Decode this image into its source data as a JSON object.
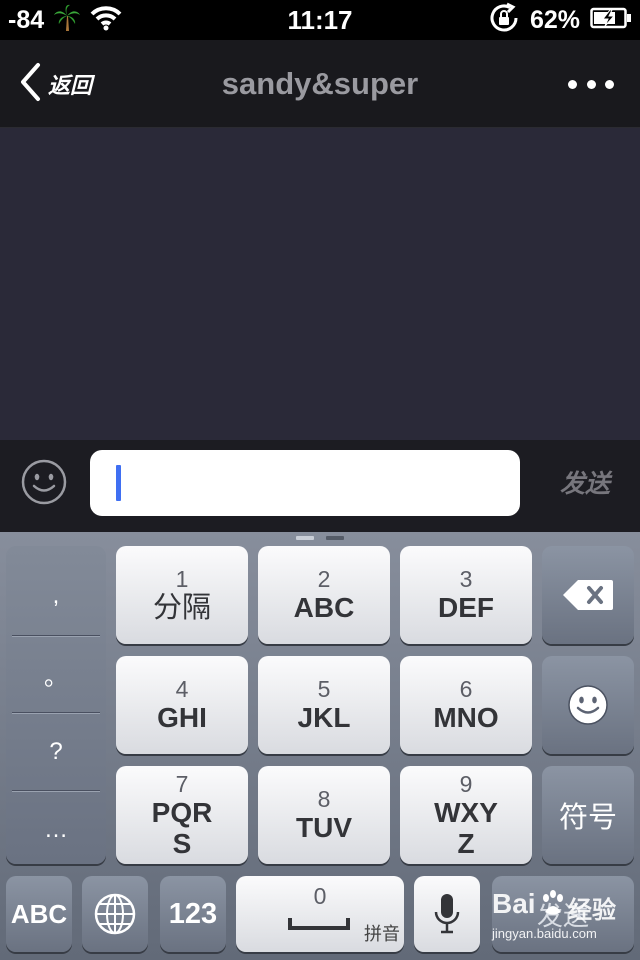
{
  "status_bar": {
    "signal": "-84",
    "time": "11:17",
    "battery": "62%",
    "icons": [
      "palm-tree-icon",
      "wifi-icon",
      "rotation-lock-icon",
      "battery-charging-icon"
    ]
  },
  "nav": {
    "back_label": "返回",
    "title": "sandy&super"
  },
  "input_bar": {
    "send_label": "发送",
    "text_value": ""
  },
  "keyboard": {
    "punctuation": [
      ",",
      "。",
      "?",
      "…"
    ],
    "keys": [
      {
        "digit": "1",
        "letters": "分隔"
      },
      {
        "digit": "2",
        "letters": "ABC"
      },
      {
        "digit": "3",
        "letters": "DEF"
      },
      {
        "digit": "4",
        "letters": "GHI"
      },
      {
        "digit": "5",
        "letters": "JKL"
      },
      {
        "digit": "6",
        "letters": "MNO"
      },
      {
        "digit": "7",
        "letters": "PQR",
        "letters2": "S"
      },
      {
        "digit": "8",
        "letters": "TUV"
      },
      {
        "digit": "9",
        "letters": "WXY",
        "letters2": "Z"
      }
    ],
    "symbols_label": "符号",
    "abc_label": "ABC",
    "num_label": "123",
    "space_digit": "0",
    "space_label": "拼音",
    "send_key_label": "发送"
  },
  "watermark": {
    "brand": "Bai",
    "brand2": "经验",
    "url": "jingyan.baidu.com"
  },
  "colors": {
    "accent": "#3f6ff2",
    "chat_bg": "#2a2938",
    "nav_bg": "#19191d"
  }
}
